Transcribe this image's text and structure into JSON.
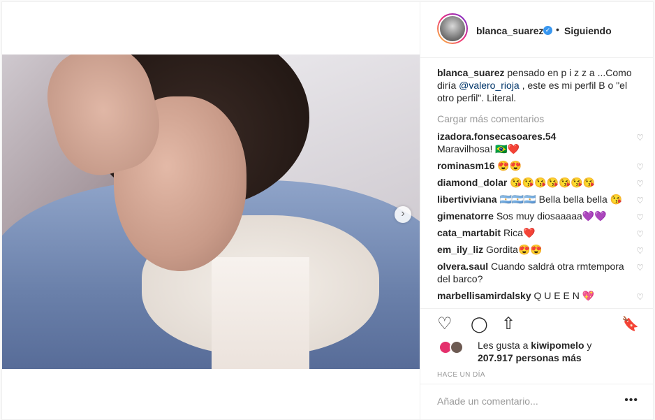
{
  "post": {
    "username": "blanca_suarez",
    "follow_status": "Siguiendo",
    "separator": "•",
    "verified_mark": "✓",
    "caption": {
      "username": "blanca_suarez",
      "text_before": " pensado en p i z z a ...Como diría ",
      "mention": "@valero_rioja",
      "text_after": " , este es mi perfil B o \"el otro perfil\". Literal."
    },
    "load_more": "Cargar más comentarios",
    "comments": [
      {
        "user": "izadora.fonsecasoares.54",
        "text": "Maravilhosa! 🇧🇷❤️"
      },
      {
        "user": "rominasm16",
        "text": "😍😍"
      },
      {
        "user": "diamond_dolar",
        "text": "😘😘😘😘😘😘😘"
      },
      {
        "user": "libertiviviana",
        "text": "🇦🇷🇦🇷🇦🇷 Bella bella bella 😘"
      },
      {
        "user": "gimenatorre",
        "text": "Sos muy diosaaaaa💜💜"
      },
      {
        "user": "cata_martabit",
        "text": "Rica❤️"
      },
      {
        "user": "em_ily_liz",
        "text": "Gordita😍😍"
      },
      {
        "user": "olvera.saul",
        "text": "Cuando saldrá otra rmtempora del barco?"
      },
      {
        "user": "marbellisamirdalsky",
        "text": "Q U E E N 💖"
      }
    ],
    "likes": {
      "prefix": "Les gusta a ",
      "user": "kiwipomelo",
      "middle": " y ",
      "count": "207.917 personas más"
    },
    "time": "HACE UN DÍA",
    "add_comment_placeholder": "Añade un comentario...",
    "more_label": "•••",
    "next_label": "›"
  },
  "icons": {
    "heart": "♡",
    "comment": "◯",
    "share": "⇧",
    "save": "🔖",
    "small_heart": "♡"
  }
}
